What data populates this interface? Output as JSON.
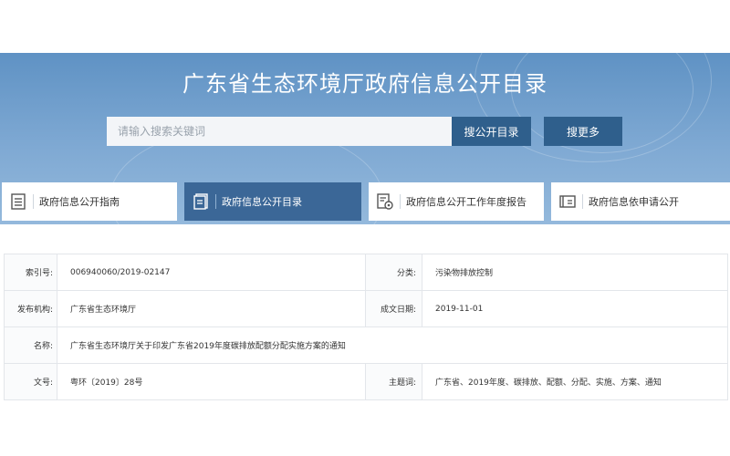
{
  "header": {
    "title": "广东省生态环境厅政府信息公开目录",
    "search_placeholder": "请输入搜索关键词",
    "search_button": "搜公开目录",
    "more_button": "搜更多"
  },
  "tabs": [
    {
      "label": "政府信息公开指南",
      "icon": "document-list-icon",
      "active": false
    },
    {
      "label": "政府信息公开目录",
      "icon": "catalog-icon",
      "active": true
    },
    {
      "label": "政府信息公开工作年度报告",
      "icon": "report-icon",
      "active": false
    },
    {
      "label": "政府信息依申请公开",
      "icon": "application-icon",
      "active": false
    }
  ],
  "info": {
    "index_label": "索引号:",
    "index_value": "006940060/2019-02147",
    "category_label": "分类:",
    "category_value": "污染物排放控制",
    "publisher_label": "发布机构:",
    "publisher_value": "广东省生态环境厅",
    "date_label": "成文日期:",
    "date_value": "2019-11-01",
    "name_label": "名称:",
    "name_value": "广东省生态环境厅关于印发广东省2019年度碳排放配额分配实施方案的通知",
    "docno_label": "文号:",
    "docno_value": "粤环〔2019〕28号",
    "keywords_label": "主题词:",
    "keywords_value": "广东省、2019年度、碳排放、配额、分配、实施、方案、通知"
  },
  "colors": {
    "banner": "#7fa9d3",
    "button": "#2f5f8c",
    "active_tab": "#3b6797"
  }
}
